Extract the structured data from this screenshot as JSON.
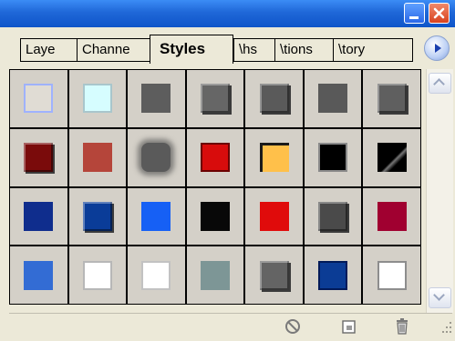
{
  "panel": {
    "tabs": [
      {
        "label": "Laye",
        "active": false
      },
      {
        "label": "Channe",
        "active": false
      },
      {
        "label": "Styles",
        "active": true
      },
      {
        "label": "\\hs",
        "active": false
      },
      {
        "label": "\\tions",
        "active": false
      },
      {
        "label": "\\tory",
        "active": false
      }
    ]
  },
  "swatches": [
    [
      {
        "name": "empty-style",
        "fill": "#e0dcd4",
        "border": "#9fb2ff"
      },
      {
        "name": "cyan-glow-style",
        "fill": "#d6fdff",
        "border": "#a9c6cc"
      },
      {
        "name": "gray-flat-style",
        "fill": "#5d5d5d"
      },
      {
        "name": "gray-bevel-style",
        "fill": "#666666",
        "bevel": true
      },
      {
        "name": "gray-emboss-style",
        "fill": "#5a5a5a",
        "bevel": true
      },
      {
        "name": "dark-gray-style",
        "fill": "#595959"
      },
      {
        "name": "gray-gloss-style",
        "fill": "#5f5f5f",
        "bevel": true
      }
    ],
    [
      {
        "name": "dark-red-bevel-style",
        "fill": "#7a0b0b",
        "bevel": true
      },
      {
        "name": "soft-red-style",
        "fill": "#b5453a"
      },
      {
        "name": "blurred-gray-style",
        "fill": "#5a5a5a",
        "blur": true
      },
      {
        "name": "red-frame-style",
        "fill": "#d80c0c",
        "border": "#6b0000"
      },
      {
        "name": "yellow-inset-style",
        "fill": "#ffc04a",
        "inset": true
      },
      {
        "name": "black-gloss-style",
        "fill": "#000000",
        "border": "#8a8a8a"
      },
      {
        "name": "black-shine-style",
        "fill": "#111111",
        "shine": true
      }
    ],
    [
      {
        "name": "navy-style",
        "fill": "#0f2d8d"
      },
      {
        "name": "dark-blue-bevel-style",
        "fill": "#0a3c98",
        "bevel": true
      },
      {
        "name": "bright-blue-style",
        "fill": "#1660f5"
      },
      {
        "name": "black-flat-style",
        "fill": "#080808"
      },
      {
        "name": "red-flat-style",
        "fill": "#e00b0b"
      },
      {
        "name": "charcoal-bevel-style",
        "fill": "#4a4a4a",
        "bevel": true
      },
      {
        "name": "crimson-style",
        "fill": "#a00030"
      }
    ],
    [
      {
        "name": "medium-blue-style",
        "fill": "#336cd4"
      },
      {
        "name": "white-style",
        "fill": "#ffffff",
        "border": "#b7b7b7"
      },
      {
        "name": "white-plain-style",
        "fill": "#ffffff",
        "border": "#c2c2c2"
      },
      {
        "name": "teal-gray-style",
        "fill": "#7d9696"
      },
      {
        "name": "gray-steel-style",
        "fill": "#646464",
        "bevel": true
      },
      {
        "name": "blue-frame-style",
        "fill": "#0b3c95",
        "border": "#001a59"
      },
      {
        "name": "white-bevel-style",
        "fill": "#ffffff",
        "border": "#8d8d8d"
      }
    ]
  ],
  "icons": {
    "clear": "no-entry-icon",
    "new": "new-style-icon",
    "delete": "trash-icon"
  }
}
